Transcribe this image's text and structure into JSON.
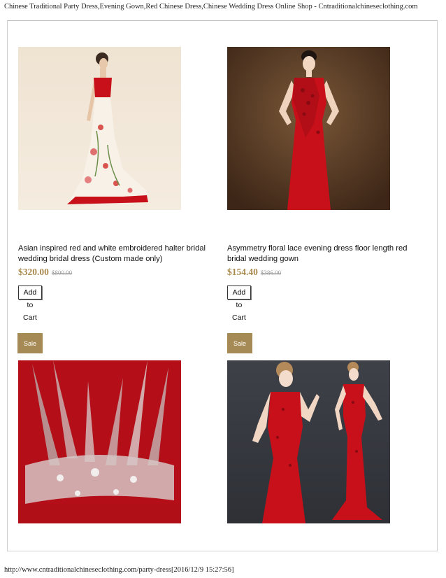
{
  "page": {
    "header_text": "Chinese Traditional Party Dress,Evening Gown,Red Chinese Dress,Chinese Wedding Dress Online Shop - Cntraditionalchineseclothing.com",
    "footer_text": "http://www.cntraditionalchineseclothing.com/party-dress[2016/12/9 15:27:56]"
  },
  "products": [
    {
      "title": "Asian inspired red and white embroidered halter bridal wedding bridal dress (Custom made only)",
      "price": "$320.00",
      "old_price": "$800.00",
      "cart_label": "Add to Cart",
      "image_icon": "white-embroidered-gown-photo"
    },
    {
      "title": "Asymmetry floral lace evening dress floor length red bridal wedding gown",
      "price": "$154.40",
      "old_price": "$386.00",
      "cart_label": "Add to Cart",
      "image_icon": "red-lace-evening-dress-photo"
    },
    {
      "badge": "Sale",
      "image_icon": "red-beaded-bodice-photo"
    },
    {
      "badge": "Sale",
      "image_icon": "red-lace-mermaid-dress-photo"
    }
  ],
  "colors": {
    "price": "#a98a4c",
    "sale_badge": "#a68a55",
    "dress_red": "#c8101a"
  }
}
